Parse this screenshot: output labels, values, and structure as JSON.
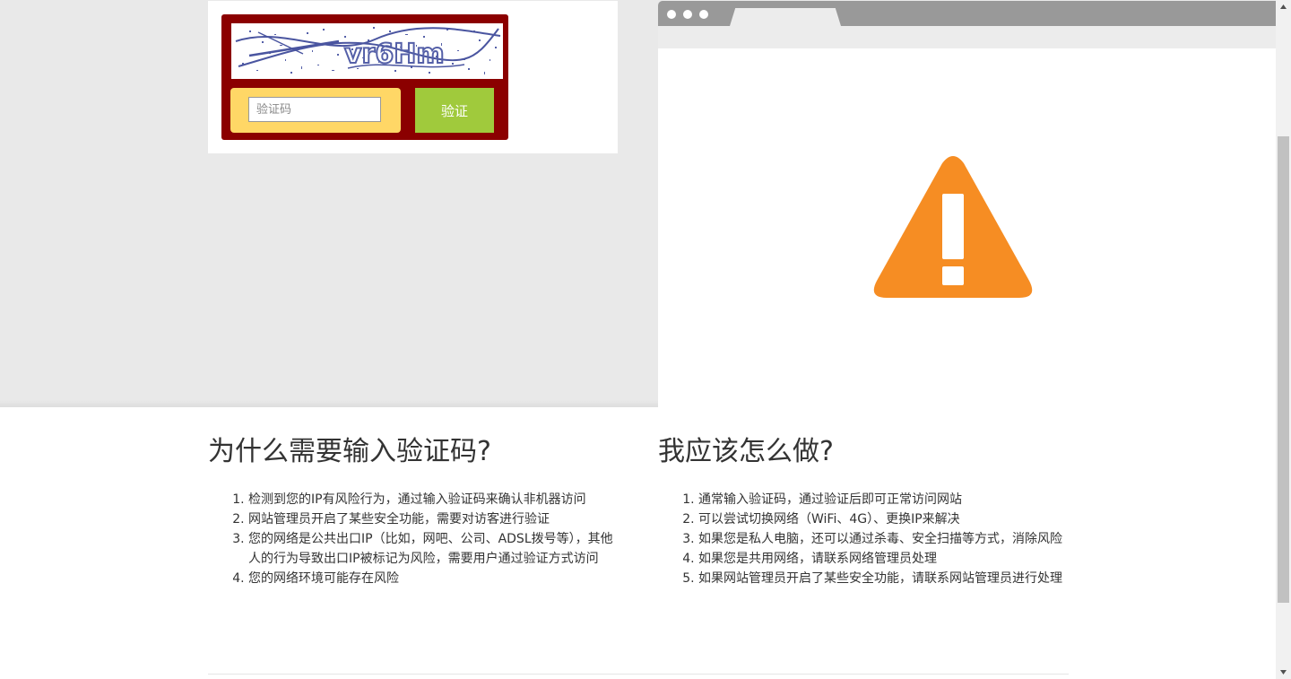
{
  "captcha": {
    "image_text": "vr6Hm",
    "input_placeholder": "验证码",
    "input_value": "",
    "verify_label": "验证",
    "colors": {
      "frame": "#8b0000",
      "input_bg": "#ffd766",
      "button": "#a0ca3c"
    }
  },
  "illustration": {
    "icon": "warning-icon",
    "icon_color": "#f68d23"
  },
  "why": {
    "title": "为什么需要输入验证码?",
    "items": [
      "检测到您的IP有风险行为，通过输入验证码来确认非机器访问",
      "网站管理员开启了某些安全功能，需要对访客进行验证",
      "您的网络是公共出口IP（比如，网吧、公司、ADSL拨号等），其他人的行为导致出口IP被标记为风险，需要用户通过验证方式访问",
      "您的网络环境可能存在风险"
    ]
  },
  "what": {
    "title": "我应该怎么做?",
    "items": [
      "通常输入验证码，通过验证后即可正常访问网站",
      "可以尝试切换网络（WiFi、4G）、更换IP来解决",
      "如果您是私人电脑，还可以通过杀毒、安全扫描等方式，消除风险",
      "如果您是共用网络，请联系网络管理员处理",
      "如果网站管理员开启了某些安全功能，请联系网站管理员进行处理"
    ]
  }
}
